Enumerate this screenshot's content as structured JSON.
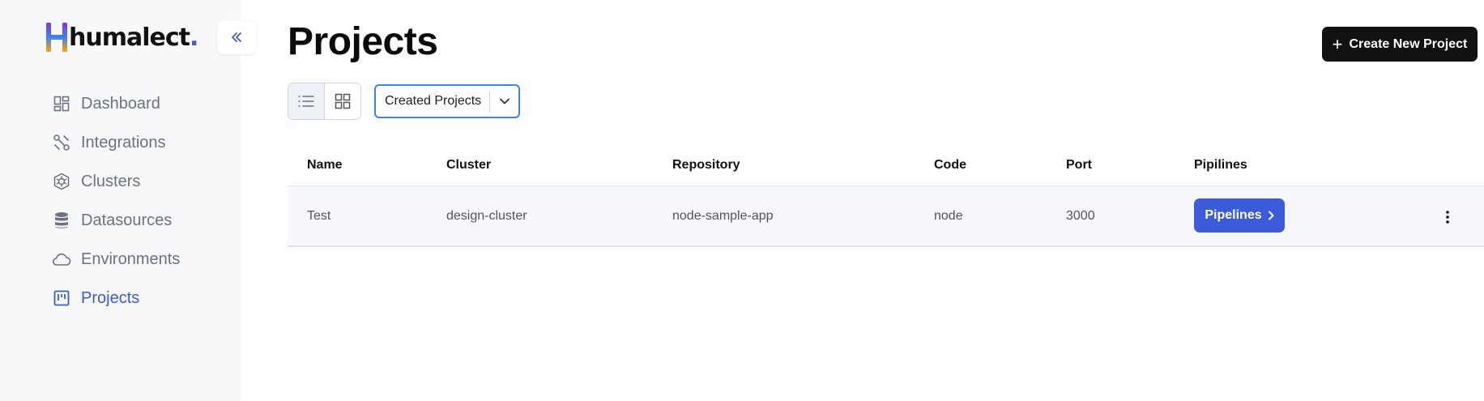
{
  "brand": {
    "name": "humalect",
    "dot": "."
  },
  "sidebar": {
    "items": [
      {
        "label": "Dashboard",
        "icon": "dashboard-icon",
        "active": false
      },
      {
        "label": "Integrations",
        "icon": "integrations-icon",
        "active": false
      },
      {
        "label": "Clusters",
        "icon": "clusters-icon",
        "active": false
      },
      {
        "label": "Datasources",
        "icon": "database-icon",
        "active": false
      },
      {
        "label": "Environments",
        "icon": "cloud-icon",
        "active": false
      },
      {
        "label": "Projects",
        "icon": "projects-icon",
        "active": true
      }
    ]
  },
  "header": {
    "title": "Projects",
    "create_label": "Create New Project"
  },
  "filter": {
    "selected": "Created Projects"
  },
  "table": {
    "columns": [
      "Name",
      "Cluster",
      "Repository",
      "Code",
      "Port",
      "Pipilines"
    ],
    "rows": [
      {
        "name": "Test",
        "cluster": "design-cluster",
        "repository": "node-sample-app",
        "code": "node",
        "port": "3000",
        "pipelines_label": "Pipelines"
      }
    ]
  },
  "colors": {
    "accent": "#3b5bdb",
    "sidebar_bg": "#f7f8fa",
    "primary_button": "#111111",
    "select_border": "#3b82f6"
  }
}
